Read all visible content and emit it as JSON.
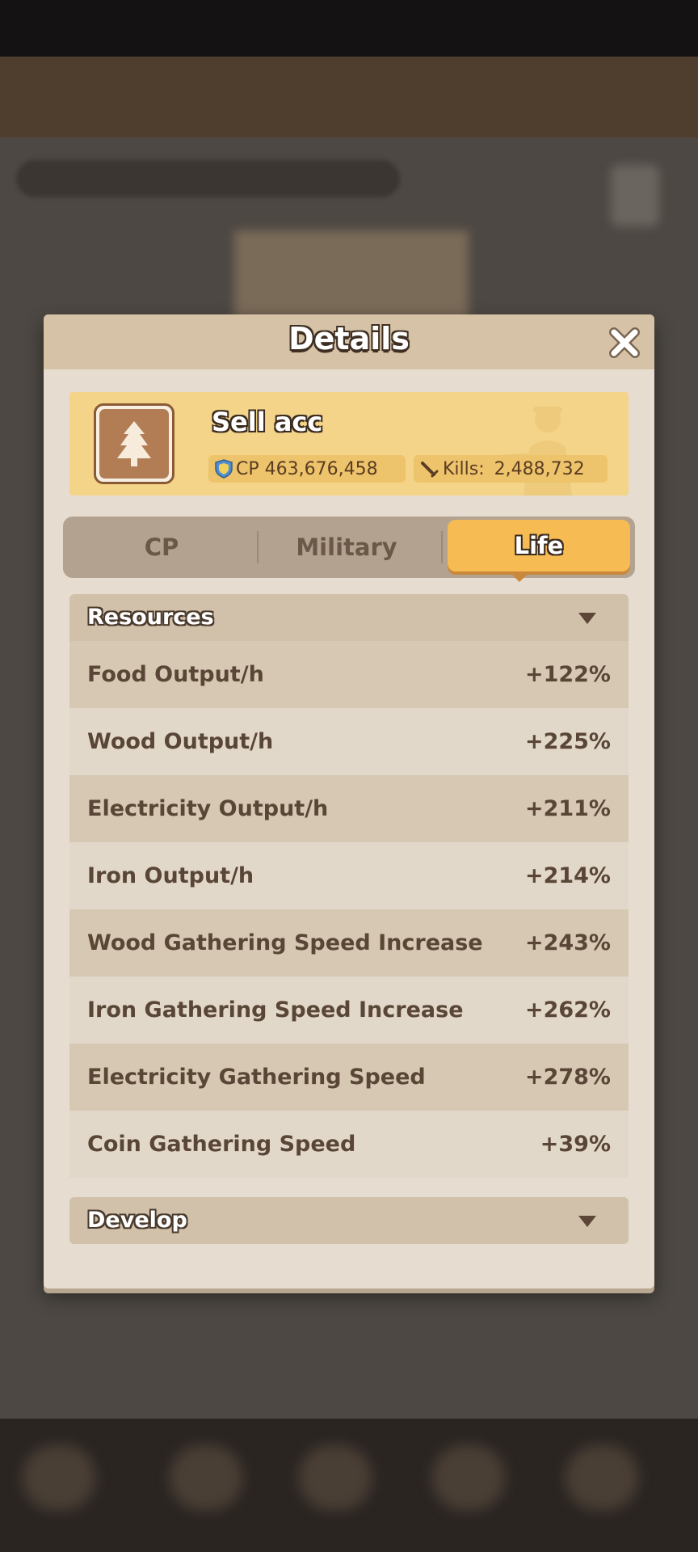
{
  "dialog": {
    "title": "Details"
  },
  "profile": {
    "name": "Sell acc",
    "cp_value": "CP 463,676,458",
    "kills_label": "Kills:",
    "kills_value": "2,488,732"
  },
  "tabs": [
    {
      "label": "CP",
      "active": false
    },
    {
      "label": "Military",
      "active": false
    },
    {
      "label": "Life",
      "active": true
    }
  ],
  "resources": {
    "title": "Resources",
    "rows": [
      {
        "label": "Food Output/h",
        "value": "+122%"
      },
      {
        "label": "Wood Output/h",
        "value": "+225%"
      },
      {
        "label": "Electricity Output/h",
        "value": "+211%"
      },
      {
        "label": "Iron Output/h",
        "value": "+214%"
      },
      {
        "label": "Wood Gathering Speed Increase",
        "value": "+243%"
      },
      {
        "label": "Iron Gathering Speed Increase",
        "value": "+262%"
      },
      {
        "label": "Electricity Gathering Speed",
        "value": "+278%"
      },
      {
        "label": "Coin Gathering Speed",
        "value": "+39%"
      }
    ]
  },
  "develop": {
    "title": "Develop"
  },
  "colors": {
    "dialog_bg": "#e6ddd0",
    "header_bg": "#d6c2a6",
    "banner_bg": "#f3d488",
    "tab_active": "#f6bb52",
    "text_dark": "#5a4636"
  },
  "icons": {
    "close": "close-icon",
    "avatar": "tree-icon",
    "cp": "shield-icon",
    "kills": "sword-icon",
    "section_toggle": "chevron-down-icon"
  }
}
